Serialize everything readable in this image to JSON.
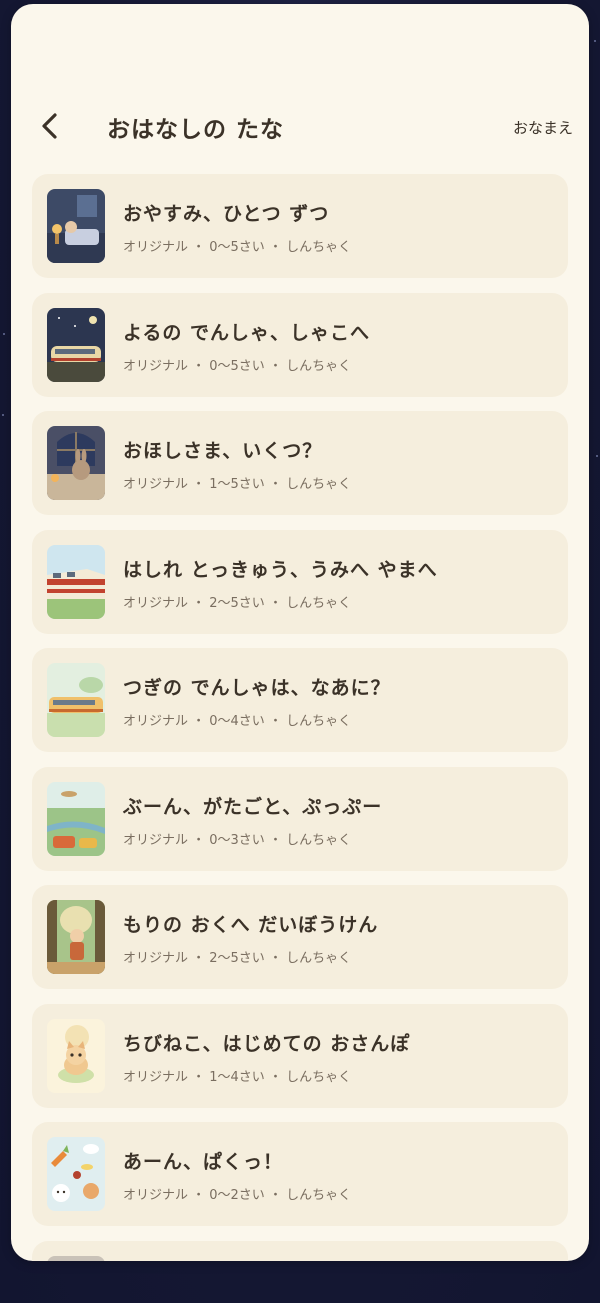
{
  "header": {
    "title": "おはなしの たな",
    "name_link": "おなまえ"
  },
  "stories": [
    {
      "title": "おやすみ、ひとつ ずつ",
      "meta": "オリジナル ・ 0〜5さい ・ しんちゃく",
      "thumb": "night-bedroom-thumbnail"
    },
    {
      "title": "よるの でんしゃ、しゃこへ",
      "meta": "オリジナル ・ 0〜5さい ・ しんちゃく",
      "thumb": "night-train-thumbnail"
    },
    {
      "title": "おほしさま、いくつ？",
      "meta": "オリジナル ・ 1〜5さい ・ しんちゃく",
      "thumb": "bunny-window-thumbnail"
    },
    {
      "title": "はしれ とっきゅう、うみへ やまへ",
      "meta": "オリジナル ・ 2〜5さい ・ しんちゃく",
      "thumb": "express-train-thumbnail"
    },
    {
      "title": "つぎの でんしゃは、なあに？",
      "meta": "オリジナル ・ 0〜4さい ・ しんちゃく",
      "thumb": "day-train-thumbnail"
    },
    {
      "title": "ぶーん、がたごと、ぷっぷー",
      "meta": "オリジナル ・ 0〜3さい ・ しんちゃく",
      "thumb": "vehicles-thumbnail"
    },
    {
      "title": "もりの おくへ だいぼうけん",
      "meta": "オリジナル ・ 2〜5さい ・ しんちゃく",
      "thumb": "forest-explorer-thumbnail"
    },
    {
      "title": "ちびねこ、はじめての おさんぽ",
      "meta": "オリジナル ・ 1〜4さい ・ しんちゃく",
      "thumb": "kitten-thumbnail"
    },
    {
      "title": "あーん、ぱくっ！",
      "meta": "オリジナル ・ 0〜2さい ・ しんちゃく",
      "thumb": "food-animals-thumbnail"
    }
  ],
  "icons": {
    "back": "chevron-left-icon"
  },
  "colors": {
    "background": "#151833",
    "sheet": "#fbf7ec",
    "card": "#f5eedd",
    "text": "#3b3228",
    "subtext": "#7a6e60"
  }
}
